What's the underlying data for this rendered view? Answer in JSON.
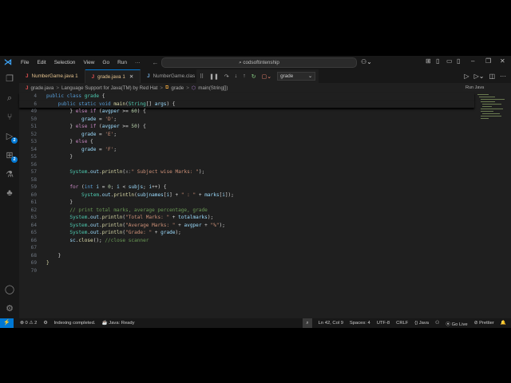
{
  "menu": [
    "File",
    "Edit",
    "Selection",
    "View",
    "Go",
    "Run",
    "···"
  ],
  "command_center": "codsoftintenship",
  "tabs": [
    {
      "label": "NumberGame.java",
      "badge": "1",
      "modified": true,
      "active": false
    },
    {
      "label": "grade.java",
      "badge": "1",
      "modified": true,
      "active": true
    },
    {
      "label": "NumberGame.clas",
      "badge": "",
      "modified": false,
      "active": false
    }
  ],
  "debug": {
    "config": "grade"
  },
  "tooltip": "Run Java",
  "breadcrumb": [
    "grade.java",
    "Language Support for Java(TM) by Red Hat",
    "grade",
    "main(String[])"
  ],
  "activity_badges": {
    "run_debug": "2",
    "extensions": "2"
  },
  "sticky": [
    {
      "n": "4",
      "tokens": [
        [
          "public ",
          "kb"
        ],
        [
          "class ",
          "kb"
        ],
        [
          "grade ",
          "t"
        ],
        [
          "{",
          "p"
        ]
      ]
    },
    {
      "n": "6",
      "tokens": [
        [
          "    public ",
          "kb"
        ],
        [
          "static ",
          "kb"
        ],
        [
          "void ",
          "kb"
        ],
        [
          "main",
          "f"
        ],
        [
          "(",
          "p"
        ],
        [
          "String",
          "t"
        ],
        [
          "[] ",
          "p"
        ],
        [
          "args",
          "v"
        ],
        [
          ") {",
          "p"
        ]
      ]
    }
  ],
  "code": [
    {
      "n": "49",
      "tokens": [
        [
          "        } ",
          "p"
        ],
        [
          "else if ",
          "k"
        ],
        [
          "(",
          "p"
        ],
        [
          "avgper ",
          "v"
        ],
        [
          ">= ",
          "p"
        ],
        [
          "60",
          "n"
        ],
        [
          ") {",
          "p"
        ]
      ]
    },
    {
      "n": "50",
      "tokens": [
        [
          "            grade ",
          "v"
        ],
        [
          "= ",
          "p"
        ],
        [
          "'D'",
          "s"
        ],
        [
          ";",
          "p"
        ]
      ]
    },
    {
      "n": "51",
      "tokens": [
        [
          "        } ",
          "p"
        ],
        [
          "else if ",
          "k"
        ],
        [
          "(",
          "p"
        ],
        [
          "avgper ",
          "v"
        ],
        [
          ">= ",
          "p"
        ],
        [
          "50",
          "n"
        ],
        [
          ") {",
          "p"
        ]
      ]
    },
    {
      "n": "52",
      "tokens": [
        [
          "            grade ",
          "v"
        ],
        [
          "= ",
          "p"
        ],
        [
          "'E'",
          "s"
        ],
        [
          ";",
          "p"
        ]
      ]
    },
    {
      "n": "53",
      "tokens": [
        [
          "        } ",
          "p"
        ],
        [
          "else ",
          "k"
        ],
        [
          "{",
          "p"
        ]
      ]
    },
    {
      "n": "54",
      "tokens": [
        [
          "            grade ",
          "v"
        ],
        [
          "= ",
          "p"
        ],
        [
          "'F'",
          "s"
        ],
        [
          ";",
          "p"
        ]
      ]
    },
    {
      "n": "55",
      "tokens": [
        [
          "        }",
          "p"
        ]
      ]
    },
    {
      "n": "56",
      "tokens": []
    },
    {
      "n": "57",
      "tokens": [
        [
          "        System",
          "t"
        ],
        [
          ".",
          "p"
        ],
        [
          "out",
          "v"
        ],
        [
          ".",
          "p"
        ],
        [
          "println",
          "f"
        ],
        [
          "(",
          "p"
        ],
        [
          "x:",
          "h"
        ],
        [
          "\" Subject wise Marks: \"",
          "s"
        ],
        [
          ");",
          "p"
        ]
      ]
    },
    {
      "n": "58",
      "tokens": []
    },
    {
      "n": "59",
      "tokens": [
        [
          "        for ",
          "k"
        ],
        [
          "(",
          "p"
        ],
        [
          "int ",
          "kb"
        ],
        [
          "i ",
          "v"
        ],
        [
          "= ",
          "p"
        ],
        [
          "0",
          "n"
        ],
        [
          "; ",
          "p"
        ],
        [
          "i ",
          "v"
        ],
        [
          "< ",
          "p"
        ],
        [
          "subjs",
          "v"
        ],
        [
          "; ",
          "p"
        ],
        [
          "i",
          "v"
        ],
        [
          "++) {",
          "p"
        ]
      ]
    },
    {
      "n": "60",
      "tokens": [
        [
          "            System",
          "t"
        ],
        [
          ".",
          "p"
        ],
        [
          "out",
          "v"
        ],
        [
          ".",
          "p"
        ],
        [
          "println",
          "f"
        ],
        [
          "(",
          "p"
        ],
        [
          "subjnames",
          "v"
        ],
        [
          "[",
          "p"
        ],
        [
          "i",
          "v"
        ],
        [
          "] + ",
          "p"
        ],
        [
          "\" : \"",
          "s"
        ],
        [
          " + ",
          "p"
        ],
        [
          "marks",
          "v"
        ],
        [
          "[",
          "p"
        ],
        [
          "i",
          "v"
        ],
        [
          "]);",
          "p"
        ]
      ]
    },
    {
      "n": "61",
      "tokens": [
        [
          "        }",
          "p"
        ]
      ]
    },
    {
      "n": "62",
      "tokens": [
        [
          "        // print total marks, average percentage, grade",
          "c"
        ]
      ]
    },
    {
      "n": "63",
      "tokens": [
        [
          "        System",
          "t"
        ],
        [
          ".",
          "p"
        ],
        [
          "out",
          "v"
        ],
        [
          ".",
          "p"
        ],
        [
          "println",
          "f"
        ],
        [
          "(",
          "p"
        ],
        [
          "\"Total Marks: \"",
          "s"
        ],
        [
          " + ",
          "p"
        ],
        [
          "totalmarks",
          "v"
        ],
        [
          ");",
          "p"
        ]
      ]
    },
    {
      "n": "64",
      "tokens": [
        [
          "        System",
          "t"
        ],
        [
          ".",
          "p"
        ],
        [
          "out",
          "v"
        ],
        [
          ".",
          "p"
        ],
        [
          "println",
          "f"
        ],
        [
          "(",
          "p"
        ],
        [
          "\"Average Marks: \"",
          "s"
        ],
        [
          " + ",
          "p"
        ],
        [
          "avgper",
          "v"
        ],
        [
          " + ",
          "p"
        ],
        [
          "\"%\"",
          "s"
        ],
        [
          ");",
          "p"
        ]
      ]
    },
    {
      "n": "65",
      "tokens": [
        [
          "        System",
          "t"
        ],
        [
          ".",
          "p"
        ],
        [
          "out",
          "v"
        ],
        [
          ".",
          "p"
        ],
        [
          "println",
          "f"
        ],
        [
          "(",
          "p"
        ],
        [
          "\"Grade: \"",
          "s"
        ],
        [
          " + ",
          "p"
        ],
        [
          "grade",
          "v"
        ],
        [
          ");",
          "p"
        ]
      ]
    },
    {
      "n": "66",
      "tokens": [
        [
          "        sc",
          "v"
        ],
        [
          ".",
          "p"
        ],
        [
          "close",
          "f"
        ],
        [
          "(); ",
          "p"
        ],
        [
          "//close scanner",
          "c"
        ]
      ]
    },
    {
      "n": "67",
      "tokens": []
    },
    {
      "n": "68",
      "tokens": [
        [
          "    }",
          "p"
        ]
      ]
    },
    {
      "n": "69",
      "tokens": [
        [
          "}",
          "f"
        ]
      ]
    },
    {
      "n": "70",
      "tokens": []
    }
  ],
  "status": {
    "errors": "0",
    "warnings": "2",
    "indexing": "Indexing completed.",
    "java": "Java: Ready",
    "position": "Ln 42, Col 9",
    "spaces": "Spaces: 4",
    "encoding": "UTF-8",
    "eol": "CRLF",
    "language": "Java",
    "golive": "Go Live",
    "prettier": "Prettier"
  },
  "colors": {
    "accent": "#0078d4",
    "background": "#1f1f1f",
    "chrome": "#181818"
  }
}
